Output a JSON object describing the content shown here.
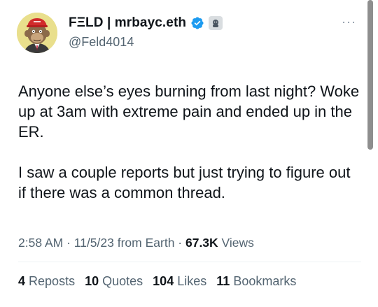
{
  "author": {
    "display_name": "FΞLD | mrbayc.eth",
    "handle": "@Feld4014",
    "avatar_icon": "bored-ape-avatar",
    "verified_icon": "verified-badge-icon",
    "affiliate_icon": "affiliate-badge-icon"
  },
  "menu": {
    "more_label": "···"
  },
  "tweet": {
    "paragraphs": [
      "Anyone else’s eyes burning from last night? Woke up at 3am with extreme pain and ended up in the ER.",
      "I saw a couple reports but just trying to figure out if there was a common thread."
    ]
  },
  "meta": {
    "time": "2:58 AM",
    "sep1": " · ",
    "date": "11/5/23 from Earth",
    "sep2": " · ",
    "views_count": "67.3K",
    "views_label": " Views"
  },
  "stats": [
    {
      "count": "4",
      "label": "Reposts"
    },
    {
      "count": "10",
      "label": "Quotes"
    },
    {
      "count": "104",
      "label": "Likes"
    },
    {
      "count": "11",
      "label": "Bookmarks"
    }
  ],
  "colors": {
    "text": "#0f1419",
    "secondary": "#536471",
    "verified": "#1d9bf0",
    "avatar_bg": "#e9df8c"
  }
}
